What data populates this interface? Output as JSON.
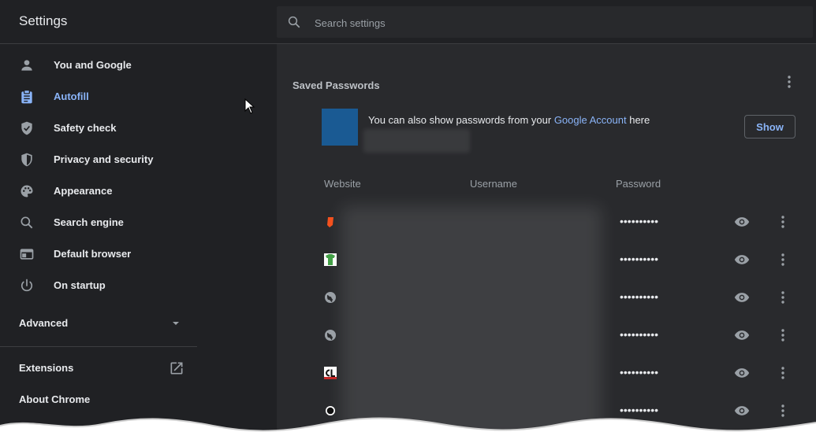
{
  "app": {
    "title": "Settings"
  },
  "search": {
    "placeholder": "Search settings"
  },
  "sidebar": {
    "items": [
      {
        "label": "You and Google",
        "icon": "person-icon",
        "active": false
      },
      {
        "label": "Autofill",
        "icon": "clipboard-icon",
        "active": true
      },
      {
        "label": "Safety check",
        "icon": "shield-check-icon",
        "active": false
      },
      {
        "label": "Privacy and security",
        "icon": "shield-icon",
        "active": false
      },
      {
        "label": "Appearance",
        "icon": "palette-icon",
        "active": false
      },
      {
        "label": "Search engine",
        "icon": "search-icon",
        "active": false
      },
      {
        "label": "Default browser",
        "icon": "browser-window-icon",
        "active": false
      },
      {
        "label": "On startup",
        "icon": "power-icon",
        "active": false
      }
    ],
    "advanced": {
      "label": "Advanced",
      "icon": "caret-down-icon"
    },
    "extensions": {
      "label": "Extensions",
      "icon": "open-in-new-icon"
    },
    "about": {
      "label": "About Chrome"
    }
  },
  "passwords": {
    "title": "Saved Passwords",
    "account_prefix": "You can also show passwords from your ",
    "account_link": "Google Account",
    "account_suffix": " here",
    "show_label": "Show",
    "columns": {
      "website": "Website",
      "username": "Username",
      "password": "Password"
    },
    "rows": [
      {
        "icon": "orange-shield-favicon",
        "password": "••••••••••"
      },
      {
        "icon": "green-tshirt-favicon",
        "password": "••••••••••"
      },
      {
        "icon": "globe-icon",
        "password": "••••••••••"
      },
      {
        "icon": "globe-icon",
        "password": "••••••••••"
      },
      {
        "icon": "cl-favicon",
        "password": "••••••••••"
      },
      {
        "icon": "circle-favicon",
        "password": "••••••••••"
      }
    ]
  },
  "colors": {
    "accent": "#8ab4f8",
    "background": "#202124",
    "card": "#292a2d",
    "account_tile": "#1a5a93"
  }
}
